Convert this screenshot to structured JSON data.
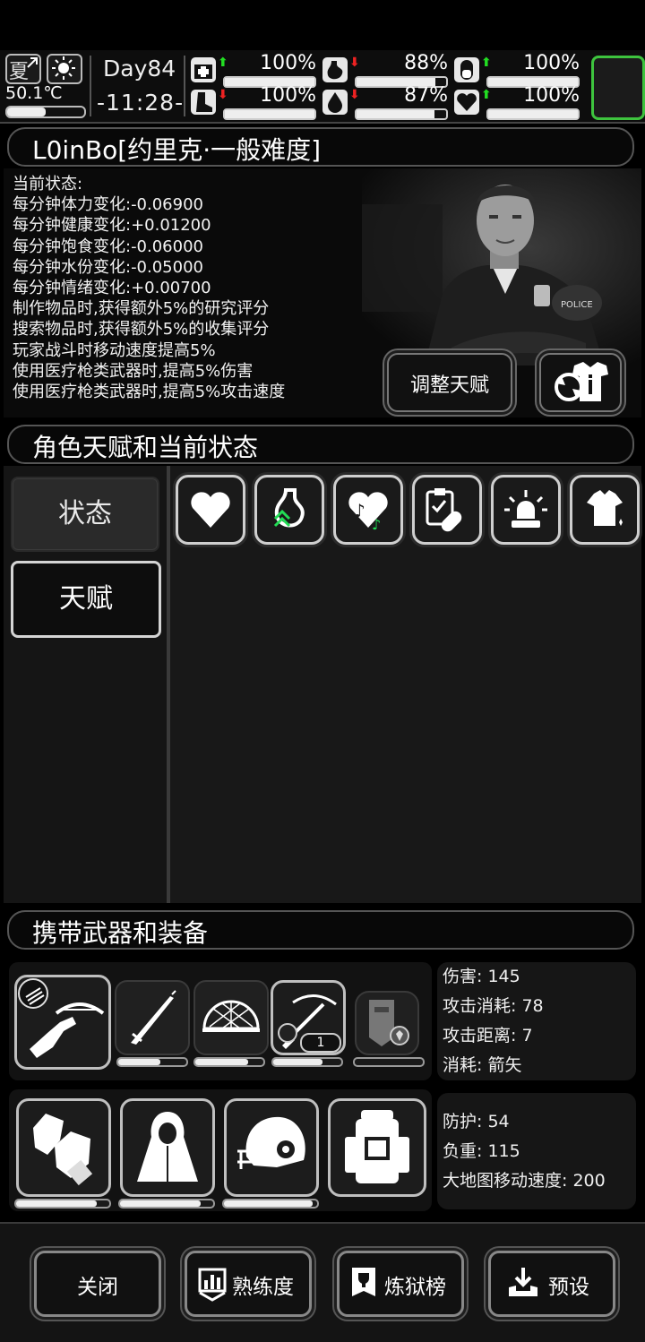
{
  "topbar": {
    "season": "夏",
    "temperature": "50.1℃",
    "temperature_level": 0.5,
    "day": "Day84",
    "clock": "-11:28-",
    "stats": [
      {
        "icon": "medkit-icon",
        "arrow": "up",
        "value": "100%",
        "level": 1.0
      },
      {
        "icon": "stomach-icon",
        "arrow": "down",
        "value": "88%",
        "level": 0.88
      },
      {
        "icon": "capsule-icon",
        "arrow": "up",
        "value": "100%",
        "level": 1.0
      },
      {
        "icon": "boot-icon",
        "arrow": "down",
        "value": "100%",
        "level": 1.0
      },
      {
        "icon": "water-drop-icon",
        "arrow": "down",
        "value": "87%",
        "level": 0.87
      },
      {
        "icon": "heart-icon",
        "arrow": "up",
        "value": "100%",
        "level": 1.0
      }
    ]
  },
  "character": {
    "header": "L0inBo[约里克·一般难度]",
    "status_lines": [
      "当前状态:",
      "每分钟体力变化:-0.06900",
      "每分钟健康变化:+0.01200",
      "每分钟饱食变化:-0.06000",
      "每分钟水份变化:-0.05000",
      "每分钟情绪变化:+0.00700",
      "制作物品时,获得额外5%的研究评分",
      "搜索物品时,获得额外5%的收集评分",
      "玩家战斗时移动速度提高5%",
      "使用医疗枪类武器时,提高5%伤害",
      "使用医疗枪类武器时,提高5%攻击速度"
    ],
    "adjust_talent_label": "调整天赋"
  },
  "talents": {
    "header": "角色天赋和当前状态",
    "tabs": [
      "状态",
      "天赋"
    ]
  },
  "equipment": {
    "header": "携带武器和装备",
    "weapon_stats": [
      "伤害: 145",
      "攻击消耗: 78",
      "攻击距离: 7",
      "消耗: 箭矢"
    ],
    "armor_stats": [
      "防护: 54",
      "负重: 115",
      "大地图移动速度: 200"
    ],
    "crossbow_ammo_count": "1",
    "weapon_durability": [
      0.62,
      0.78,
      0.72
    ],
    "armor_durability": [
      0.87,
      0.87,
      0.95
    ]
  },
  "bottom": {
    "close": "关闭",
    "proficiency": "熟练度",
    "ranking": "炼狱榜",
    "preset": "预设"
  }
}
